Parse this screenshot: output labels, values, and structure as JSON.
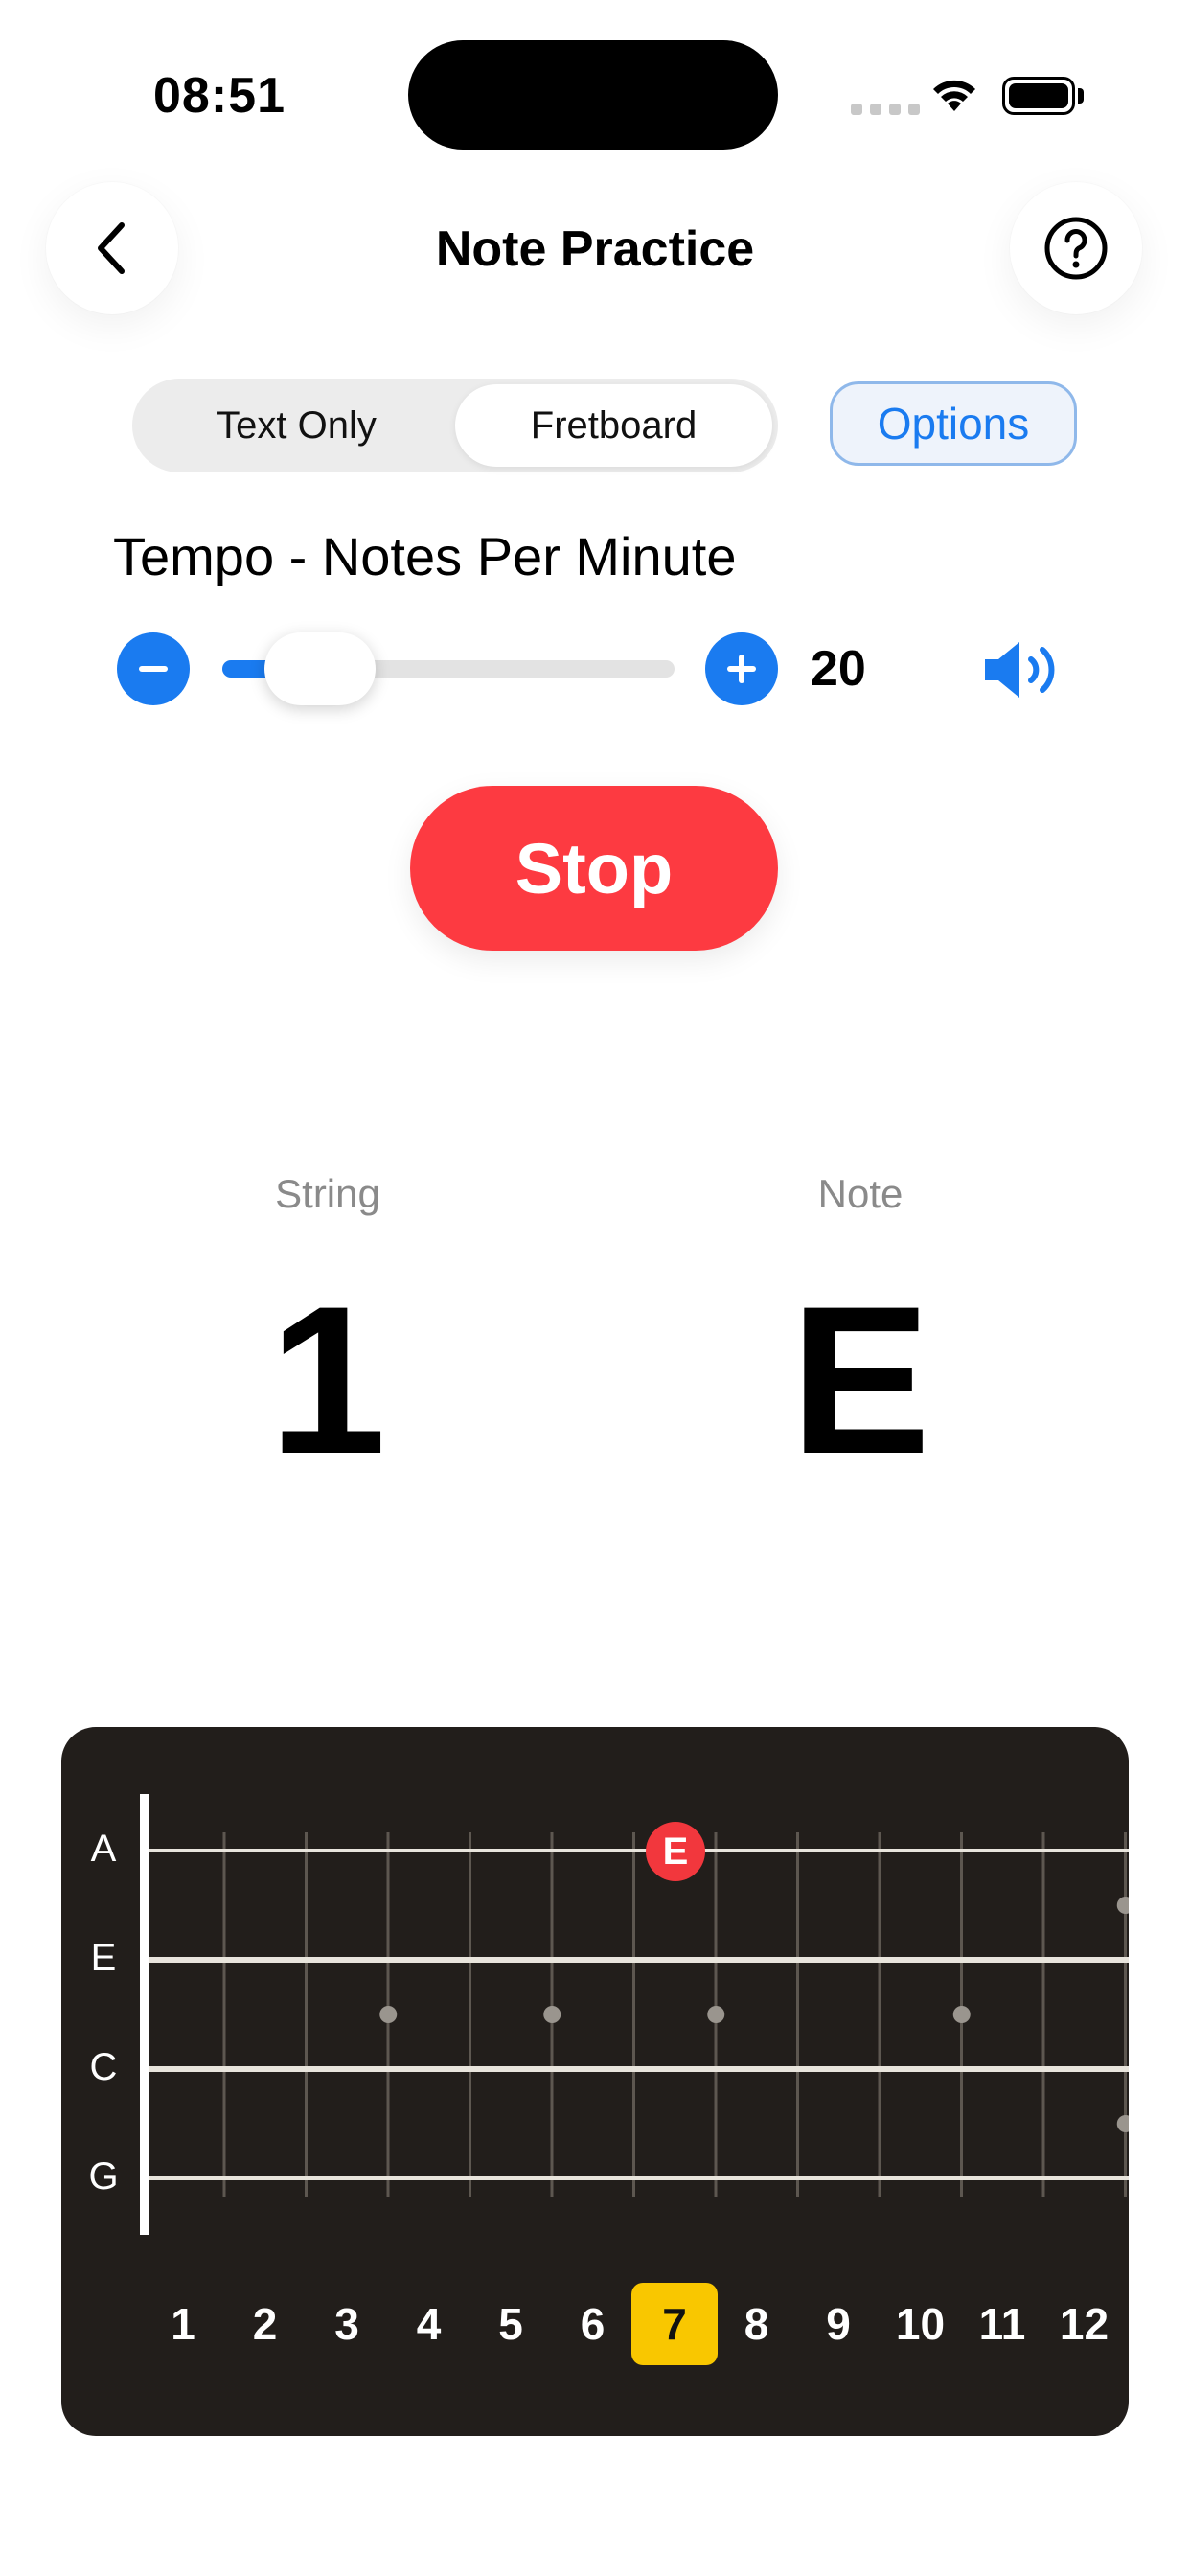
{
  "status_bar": {
    "time": "08:51"
  },
  "nav": {
    "title": "Note Practice"
  },
  "mode": {
    "options": [
      "Text Only",
      "Fretboard"
    ],
    "selected": "Fretboard"
  },
  "options_label": "Options",
  "tempo": {
    "label": "Tempo - Notes Per Minute",
    "value": "20",
    "slider_fraction": 0.15
  },
  "stop_label": "Stop",
  "current": {
    "string_label": "String",
    "string_value": "1",
    "note_label": "Note",
    "note_value": "E"
  },
  "fretboard": {
    "strings": [
      "A",
      "E",
      "C",
      "G"
    ],
    "frets": [
      "1",
      "2",
      "3",
      "4",
      "5",
      "6",
      "7",
      "8",
      "9",
      "10",
      "11",
      "12"
    ],
    "highlighted_fret": "7",
    "marker": {
      "string": "A",
      "fret": "7",
      "label": "E"
    }
  },
  "colors": {
    "accent": "#1a7bf0",
    "stop": "#fd3a41",
    "fretboard_bg": "#221e1b",
    "highlight": "#f9c700",
    "marker": "#f2373d"
  }
}
